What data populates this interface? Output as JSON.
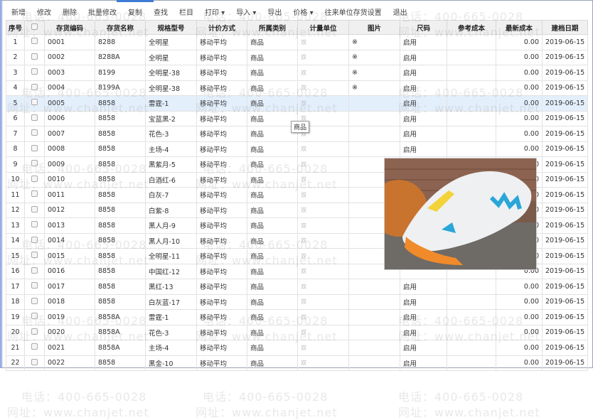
{
  "toolbar": [
    {
      "label": "新增"
    },
    {
      "label": "修改"
    },
    {
      "label": "删除"
    },
    {
      "label": "批量修改"
    },
    {
      "label": "复制"
    },
    {
      "label": "查找"
    },
    {
      "label": "栏目"
    },
    {
      "label": "打印 ▾"
    },
    {
      "label": "导入 ▾"
    },
    {
      "label": "导出"
    },
    {
      "label": "价格 ▾"
    },
    {
      "label": "往来单位存货设置"
    },
    {
      "label": "退出"
    }
  ],
  "columns": [
    "序号",
    "",
    "存货编码",
    "存货名称",
    "规格型号",
    "计价方式",
    "所属类别",
    "计量单位",
    "图片",
    "尺码",
    "参考成本",
    "最新成本",
    "建档日期"
  ],
  "rows": [
    [
      "1",
      "0001",
      "8288",
      "全明星",
      "移动平均",
      "商品",
      "双",
      "※",
      "启用",
      "",
      "0.00",
      "2019-06-15"
    ],
    [
      "2",
      "0002",
      "8288A",
      "全明星",
      "移动平均",
      "商品",
      "双",
      "※",
      "启用",
      "",
      "0.00",
      "2019-06-15"
    ],
    [
      "3",
      "0003",
      "8199",
      "全明星-38",
      "移动平均",
      "商品",
      "双",
      "※",
      "启用",
      "",
      "0.00",
      "2019-06-15"
    ],
    [
      "4",
      "0004",
      "8199A",
      "全明星-38",
      "移动平均",
      "商品",
      "双",
      "※",
      "启用",
      "",
      "0.00",
      "2019-06-15"
    ],
    [
      "5",
      "0005",
      "8858",
      "雷霆-1",
      "移动平均",
      "商品",
      "双",
      "",
      "启用",
      "",
      "0.00",
      "2019-06-15"
    ],
    [
      "6",
      "0006",
      "8858",
      "宝蓝黑-2",
      "移动平均",
      "商品",
      "双",
      "",
      "启用",
      "",
      "0.00",
      "2019-06-15"
    ],
    [
      "7",
      "0007",
      "8858",
      "花色-3",
      "移动平均",
      "商品",
      "双",
      "",
      "启用",
      "",
      "0.00",
      "2019-06-15"
    ],
    [
      "8",
      "0008",
      "8858",
      "主场-4",
      "移动平均",
      "商品",
      "双",
      "",
      "启用",
      "",
      "0.00",
      "2019-06-15"
    ],
    [
      "9",
      "0009",
      "8858",
      "黑紫月-5",
      "移动平均",
      "商品",
      "双",
      "",
      "",
      "",
      "0.00",
      "2019-06-15"
    ],
    [
      "10",
      "0010",
      "8858",
      "白酒红-6",
      "移动平均",
      "商品",
      "双",
      "",
      "",
      "",
      "0.00",
      "2019-06-15"
    ],
    [
      "11",
      "0011",
      "8858",
      "白灰-7",
      "移动平均",
      "商品",
      "双",
      "",
      "",
      "",
      "0.00",
      "2019-06-15"
    ],
    [
      "12",
      "0012",
      "8858",
      "白紫-8",
      "移动平均",
      "商品",
      "双",
      "",
      "",
      "",
      "0.00",
      "2019-06-15"
    ],
    [
      "13",
      "0013",
      "8858",
      "黑人月-9",
      "移动平均",
      "商品",
      "双",
      "",
      "",
      "",
      "0.00",
      "2019-06-15"
    ],
    [
      "14",
      "0014",
      "8858",
      "黑人月-10",
      "移动平均",
      "商品",
      "双",
      "",
      "",
      "",
      "0.00",
      "2019-06-15"
    ],
    [
      "15",
      "0015",
      "8858",
      "全明星-11",
      "移动平均",
      "商品",
      "双",
      "",
      "",
      "",
      "0.00",
      "2019-06-15"
    ],
    [
      "16",
      "0016",
      "8858",
      "中国红-12",
      "移动平均",
      "商品",
      "双",
      "",
      "",
      "",
      "0.00",
      "2019-06-15"
    ],
    [
      "17",
      "0017",
      "8858",
      "黑红-13",
      "移动平均",
      "商品",
      "双",
      "",
      "启用",
      "",
      "0.00",
      "2019-06-15"
    ],
    [
      "18",
      "0018",
      "8858",
      "白灰蓝-17",
      "移动平均",
      "商品",
      "双",
      "",
      "启用",
      "",
      "0.00",
      "2019-06-15"
    ],
    [
      "19",
      "0019",
      "8858A",
      "雷霆-1",
      "移动平均",
      "商品",
      "双",
      "",
      "启用",
      "",
      "0.00",
      "2019-06-15"
    ],
    [
      "20",
      "0020",
      "8858A",
      "花色-3",
      "移动平均",
      "商品",
      "双",
      "",
      "启用",
      "",
      "0.00",
      "2019-06-15"
    ],
    [
      "21",
      "0021",
      "8858A",
      "主场-4",
      "移动平均",
      "商品",
      "双",
      "",
      "启用",
      "",
      "0.00",
      "2019-06-15"
    ],
    [
      "22",
      "0022",
      "8858",
      "黑金-10",
      "移动平均",
      "商品",
      "双",
      "",
      "启用",
      "",
      "0.00",
      "2019-06-15"
    ]
  ],
  "selected_row": 5,
  "tooltip": "商品",
  "watermark": {
    "phone": "电话：400-665-0028",
    "site": "网址：www.chanjet.net"
  }
}
